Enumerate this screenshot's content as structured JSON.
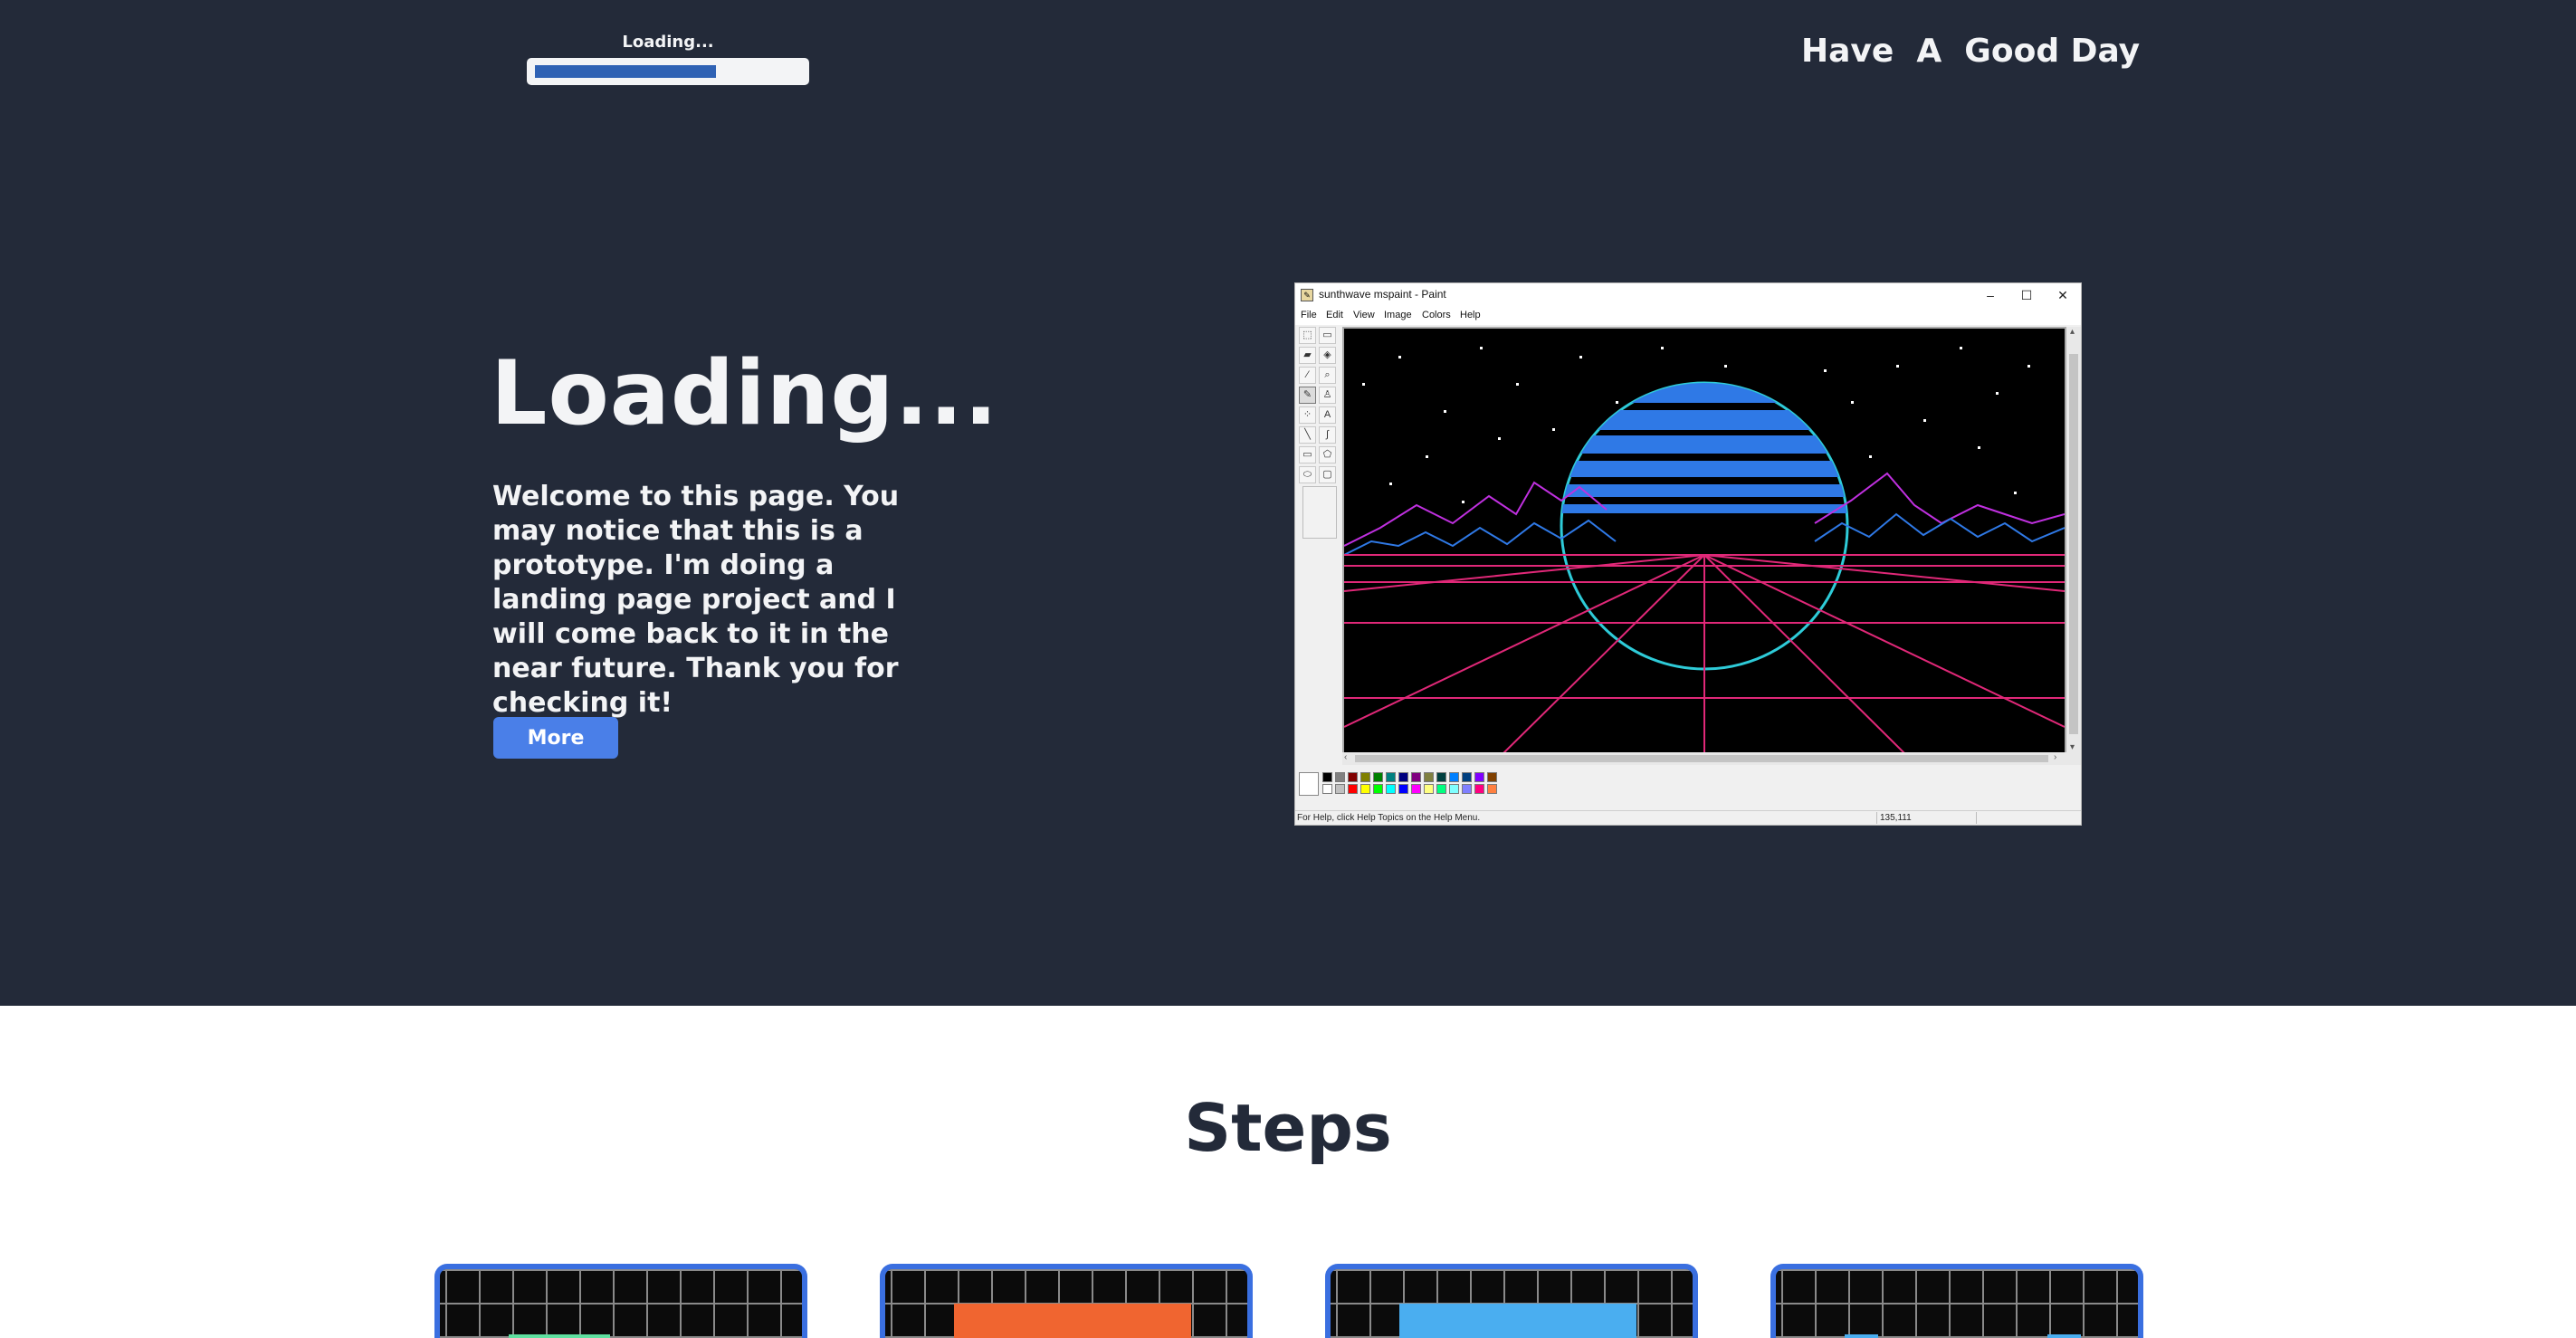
{
  "header": {
    "loading_label": "Loading...",
    "loading_progress": 0.68,
    "tagline": "Have  A  Good Day"
  },
  "hero": {
    "title": "Loading...",
    "text": "Welcome to this page. You may notice that this is a prototype. I'm doing a landing page project and I will come back to it in the near future. Thank you for checking it!",
    "button_label": "More",
    "button_color": "#4a7fe8"
  },
  "paint_window": {
    "title": "sunthwave mspaint - Paint",
    "controls": {
      "minimize": "–",
      "maximize": "☐",
      "close": "✕"
    },
    "menu": [
      "File",
      "Edit",
      "View",
      "Image",
      "Colors",
      "Help"
    ],
    "status_text": "For Help, click Help Topics on the Help Menu.",
    "coordinates": "135,111",
    "palette_top": [
      "#000000",
      "#808080",
      "#800000",
      "#808000",
      "#008000",
      "#008080",
      "#000080",
      "#800080",
      "#808040",
      "#004040",
      "#0080ff",
      "#004080",
      "#8000ff",
      "#804000"
    ],
    "palette_bottom": [
      "#ffffff",
      "#c0c0c0",
      "#ff0000",
      "#ffff00",
      "#00ff00",
      "#00ffff",
      "#0000ff",
      "#ff00ff",
      "#ffff80",
      "#00ff80",
      "#80ffff",
      "#8080ff",
      "#ff0080",
      "#ff8040"
    ]
  },
  "steps": {
    "title": "Steps",
    "card_colors": [
      "#5fe0a0",
      "#f06530",
      "#4aaef0",
      "#4aaef0"
    ]
  }
}
